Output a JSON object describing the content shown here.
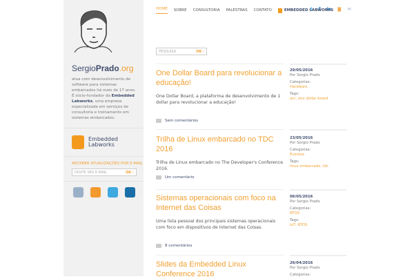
{
  "nav": {
    "items": [
      "HOME",
      "SOBRE",
      "CONSULTORIA",
      "PALESTRAS",
      "CONTATO"
    ],
    "embedded": "EMBEDDED LABWORKS",
    "social": [
      "t",
      "f",
      "in",
      "rss",
      "mail"
    ]
  },
  "search": {
    "placeholder": "PESQUISA",
    "ok": "OK ›"
  },
  "sidebar": {
    "logo_a": "Sergio",
    "logo_b": "Prado",
    ".org": "",
    "logo_c": ".org",
    "desc_1": "atua com desenvolvimento de software para sistemas embarcados há mais de 17 anos. É sócio-fundador da ",
    "desc_link": "Embedded Labworks",
    "desc_2": ", uma empresa especializada em serviços de consultoria e treinamento em sistemas embarcados.",
    "brand_1": "Embedded",
    "brand_2": "Labworks",
    "subscribe": "RECEBER ATUALIZAÇÕES POR E-MAIL",
    "email_placeholder": "DIGITE SEU E-MAIL",
    "email_ok": "OK ›"
  },
  "posts": [
    {
      "title": "One Dollar Board para revolucionar a educação!",
      "excerpt": "One Dollar Board, a plataforma de desenvolvimento de 1 dollar para revolucionar a educação!",
      "comments": "Sem comentários",
      "date": "29/05/2016",
      "author": "Por Sergio Prado",
      "cat_label": "Categorias:",
      "cat": "Hardware",
      "tags_label": "Tags:",
      "tags": "avr, one dollar board"
    },
    {
      "title": "Trilha de Linux embarcado no TDC 2016",
      "excerpt": "Trilha de Linux embarcado no The Developer's Conference 2016.",
      "comments": "Um comentário",
      "date": "23/05/2016",
      "author": "Por Sergio Prado",
      "cat_label": "Categorias:",
      "cat": "Eventos",
      "tags_label": "Tags:",
      "tags": "linux embarcado, tdc"
    },
    {
      "title": "Sistemas operacionais com foco na Internet das Coisas",
      "excerpt": "Uma lista pessoal dos principais sistemas operacionais com foco em dispositivos de Internet das Coisas.",
      "comments": "8 comentários",
      "date": "06/05/2016",
      "author": "Por Sergio Prado",
      "cat_label": "Categorias:",
      "cat": "RTOS",
      "tags_label": "Tags:",
      "tags": "IoT, RTOS"
    },
    {
      "title": "Slides da Embedded Linux Conference 2016",
      "date": "26/04/2016",
      "author": "Por Sergio Prado",
      "cat_label": "Categorias:"
    }
  ]
}
